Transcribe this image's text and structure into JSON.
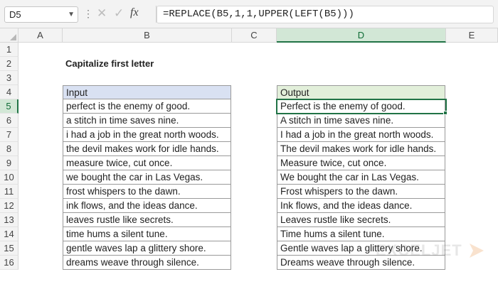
{
  "formula_bar": {
    "name_box": "D5",
    "formula": "=REPLACE(B5,1,1,UPPER(LEFT(B5)))",
    "fx_label": "fx"
  },
  "columns": [
    "A",
    "B",
    "C",
    "D",
    "E"
  ],
  "rows": [
    "1",
    "2",
    "3",
    "4",
    "5",
    "6",
    "7",
    "8",
    "9",
    "10",
    "11",
    "12",
    "13",
    "14",
    "15",
    "16"
  ],
  "sheet": {
    "title": "Capitalize first letter",
    "input_header": "Input",
    "output_header": "Output",
    "inputs": [
      "perfect is the enemy of good.",
      "a stitch in time saves nine.",
      "i had a job in the great north woods.",
      "the devil makes work for idle hands.",
      "measure twice, cut once.",
      "we bought the car in Las Vegas.",
      "frost whispers to the dawn.",
      "ink flows, and the ideas dance.",
      "leaves rustle like secrets.",
      "time hums a silent tune.",
      "gentle waves lap a glittery shore.",
      "dreams weave through silence."
    ],
    "outputs": [
      "Perfect is the enemy of good.",
      "A stitch in time saves nine.",
      "I had a job in the great north woods.",
      "The devil makes work for idle hands.",
      "Measure twice, cut once.",
      "We bought the car in Las Vegas.",
      "Frost whispers to the dawn.",
      "Ink flows, and the ideas dance.",
      "Leaves rustle like secrets.",
      "Time hums a silent tune.",
      "Gentle waves lap a glittery shore.",
      "Dreams weave through silence."
    ]
  },
  "watermark": "EXCELJET",
  "colors": {
    "accent": "#217346",
    "input_header_bg": "#d9e1f2",
    "output_header_bg": "#e2efda"
  }
}
